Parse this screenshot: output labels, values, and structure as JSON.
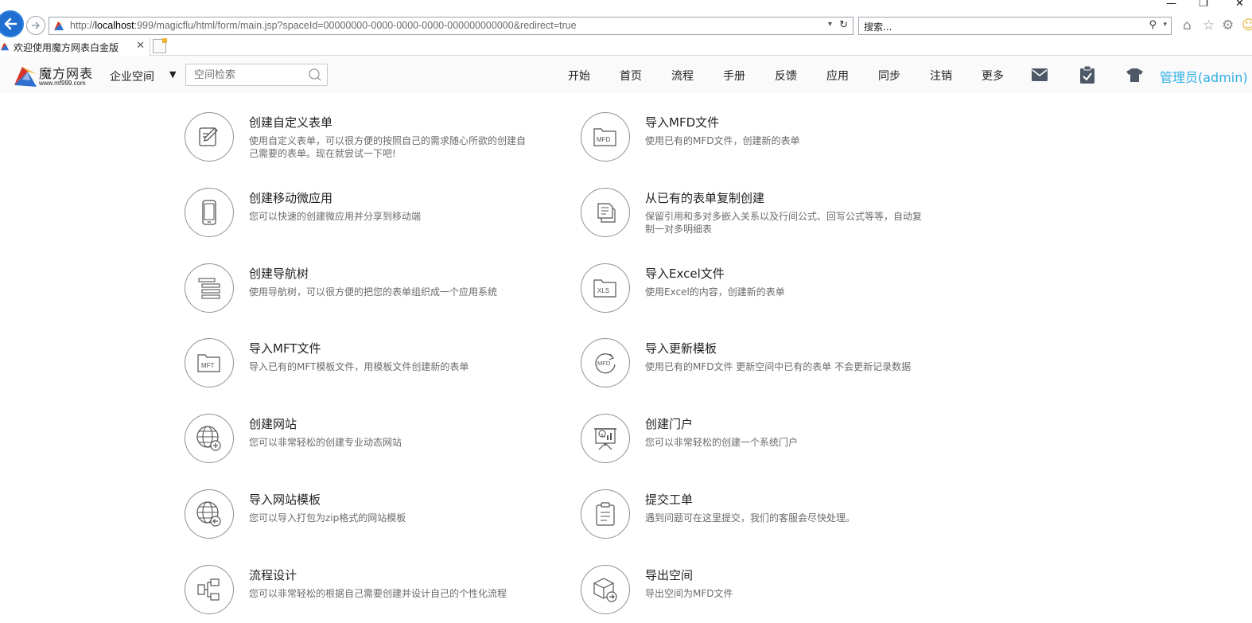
{
  "browser": {
    "address_prefix": "http://",
    "address_host": "localhost",
    "address_rest": ":999/magicflu/html/form/main.jsp?spaceId=00000000-0000-0000-0000-000000000000&redirect=true",
    "search_placeholder": "搜索...",
    "tab_title": "欢迎使用魔方网表白金版",
    "icons": [
      "back-icon",
      "forward-icon",
      "refresh-icon",
      "search-icon",
      "home-icon",
      "star-icon",
      "gear-icon",
      "smiley-icon"
    ]
  },
  "header": {
    "logo_text": "魔方网表",
    "logo_url": "www.mf999.com",
    "space_label": "企业空间",
    "space_search_placeholder": "空间检索",
    "nav": [
      "开始",
      "首页",
      "流程",
      "手册",
      "反馈",
      "应用",
      "同步",
      "注销",
      "更多"
    ],
    "user": "管理员(admin)",
    "accent_color": "#2eaee8"
  },
  "cards": {
    "left": [
      {
        "title": "创建自定义表单",
        "desc": "使用自定义表单，可以很方便的按照自己的需求随心所欲的创建自己需要的表单。现在就尝试一下吧!",
        "icon": "edit-form-icon"
      },
      {
        "title": "创建移动微应用",
        "desc": "您可以快速的创建微应用并分享到移动端",
        "icon": "mobile-icon"
      },
      {
        "title": "创建导航树",
        "desc": "使用导航树，可以很方便的把您的表单组织成一个应用系统",
        "icon": "navtree-icon"
      },
      {
        "title": "导入MFT文件",
        "desc": "导入已有的MFT模板文件，用模板文件创建新的表单",
        "icon": "mft-file-icon"
      },
      {
        "title": "创建网站",
        "desc": "您可以非常轻松的创建专业动态网站",
        "icon": "globe-add-icon"
      },
      {
        "title": "导入网站模板",
        "desc": "您可以导入打包为zip格式的网站模板",
        "icon": "globe-import-icon"
      },
      {
        "title": "流程设计",
        "desc": "您可以非常轻松的根据自己需要创建并设计自己的个性化流程",
        "icon": "flow-icon"
      }
    ],
    "right": [
      {
        "title": "导入MFD文件",
        "desc": "使用已有的MFD文件，创建新的表单",
        "icon": "mfd-file-icon"
      },
      {
        "title": "从已有的表单复制创建",
        "desc": "保留引用和多对多嵌入关系以及行间公式、回写公式等等，自动复制一对多明细表",
        "icon": "copy-form-icon"
      },
      {
        "title": "导入Excel文件",
        "desc": "使用Excel的内容，创建新的表单",
        "icon": "xls-file-icon"
      },
      {
        "title": "导入更新模板",
        "desc": "使用已有的MFD文件 更新空间中已有的表单 不会更新记录数据",
        "icon": "update-template-icon"
      },
      {
        "title": "创建门户",
        "desc": "您可以非常轻松的创建一个系统门户",
        "icon": "portal-icon"
      },
      {
        "title": "提交工单",
        "desc": "遇到问题可在这里提交，我们的客服会尽快处理。",
        "icon": "clipboard-icon"
      },
      {
        "title": "导出空间",
        "desc": "导出空间为MFD文件",
        "icon": "export-box-icon"
      }
    ]
  }
}
